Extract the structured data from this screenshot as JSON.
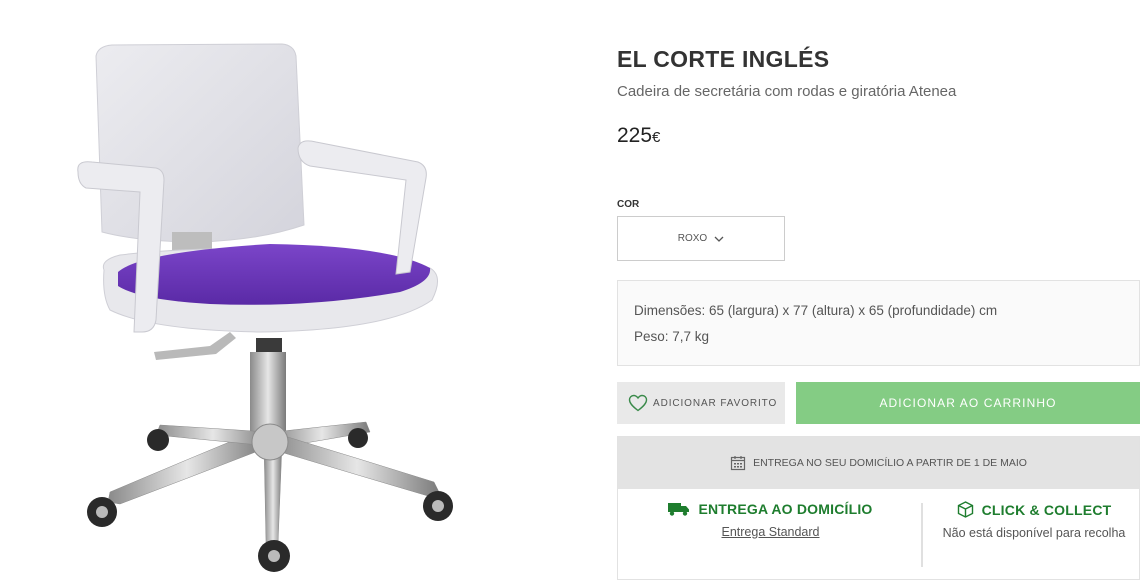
{
  "product": {
    "brand": "EL CORTE INGLÉS",
    "name": "Cadeira de secretária com rodas e giratória Atenea",
    "price_value": "225",
    "price_currency": "€",
    "image_icon": "office-chair-image"
  },
  "color": {
    "label": "COR",
    "selected": "ROXO",
    "seat_color": "#6a35b8"
  },
  "specs": {
    "dimensions": "Dimensões: 65 (largura) x 77 (altura) x 65 (profundidade) cm",
    "weight": "Peso: 7,7 kg"
  },
  "actions": {
    "favorite_label": "ADICIONAR FAVORITO",
    "cart_label": "ADICIONAR AO CARRINHO",
    "cart_color": "#84cc84"
  },
  "delivery": {
    "banner": "ENTREGA NO SEU DOMICÍLIO A PARTIR DE 1  DE MAIO",
    "home_title": "ENTREGA AO DOMICÍLIO",
    "home_sub": "Entrega Standard",
    "click_title": "CLICK & COLLECT",
    "click_sub": "Não está disponível para recolha",
    "accent_color": "#1e7d2e"
  }
}
